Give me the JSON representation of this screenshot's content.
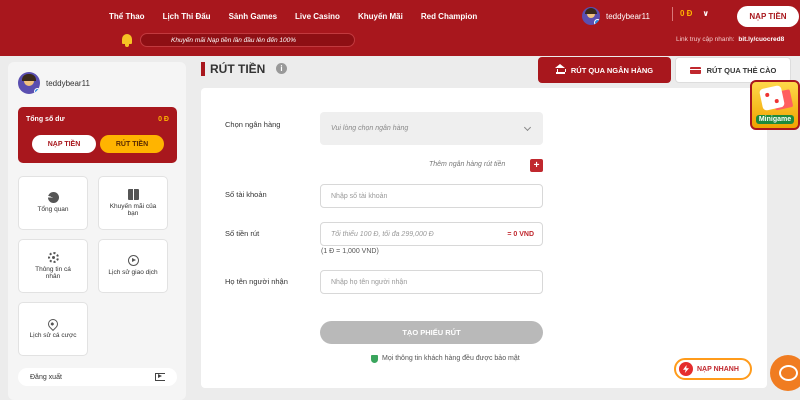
{
  "nav": [
    "Thể Thao",
    "Lịch Thi Đấu",
    "Sảnh Games",
    "Live Casino",
    "Khuyến Mãi",
    "Red Champion"
  ],
  "user": {
    "name": "teddybear11",
    "balance": "0 Đ"
  },
  "header": {
    "deposit_button": "NẠP TIỀN",
    "marquee": "Khuyến mãi Nạp tiền lần đầu lên đến 100%",
    "quick_link_label": "Link truy cập nhanh:",
    "quick_link_url": "bit.ly/cuocred8"
  },
  "sidebar": {
    "balance_label": "Tổng số dư",
    "balance_value": "0 Đ",
    "deposit_button": "NẠP TIỀN",
    "withdraw_button": "RÚT TIỀN",
    "tiles": [
      {
        "label": "Tổng quan",
        "icon": "pie-chart-icon"
      },
      {
        "label": "Khuyến mãi của bạn",
        "icon": "gift-icon"
      },
      {
        "label": "Thông tin cá nhân",
        "icon": "gear-icon"
      },
      {
        "label": "Lịch sử giao dịch",
        "icon": "play-circle-icon"
      },
      {
        "label": "Lịch sử cá cược",
        "icon": "location-pin-icon"
      }
    ],
    "logout": "Đăng xuất"
  },
  "main": {
    "title": "RÚT TIỀN",
    "tab_bank": "RÚT QUA NGÂN HÀNG",
    "tab_card": "RÚT QUA THẺ CÀO",
    "form": {
      "bank_label": "Chọn ngân hàng",
      "bank_placeholder": "Vui lòng chọn ngân hàng",
      "add_bank": "Thêm ngân hàng rút tiền",
      "account_label": "Số tài khoản",
      "account_placeholder": "Nhập số tài khoản",
      "amount_label": "Số tiền rút",
      "amount_placeholder": "Tối thiểu 100 Đ, tối đa 299,000 Đ",
      "amount_vnd": "= 0 VND",
      "rate": "(1 Đ = 1,000 VND)",
      "name_label": "Họ tên người nhận",
      "name_placeholder": "Nhập họ tên người nhận",
      "submit": "TẠO PHIẾU RÚT",
      "secure_note": "Mọi thông tin khách hàng đều được bảo mật"
    }
  },
  "floating": {
    "minigame": "Minigame",
    "quick_deposit": "NẠP NHANH"
  },
  "colors": {
    "brand_red": "#a8171d",
    "accent_yellow": "#ffb400",
    "quick_orange": "#ff9b1b"
  }
}
